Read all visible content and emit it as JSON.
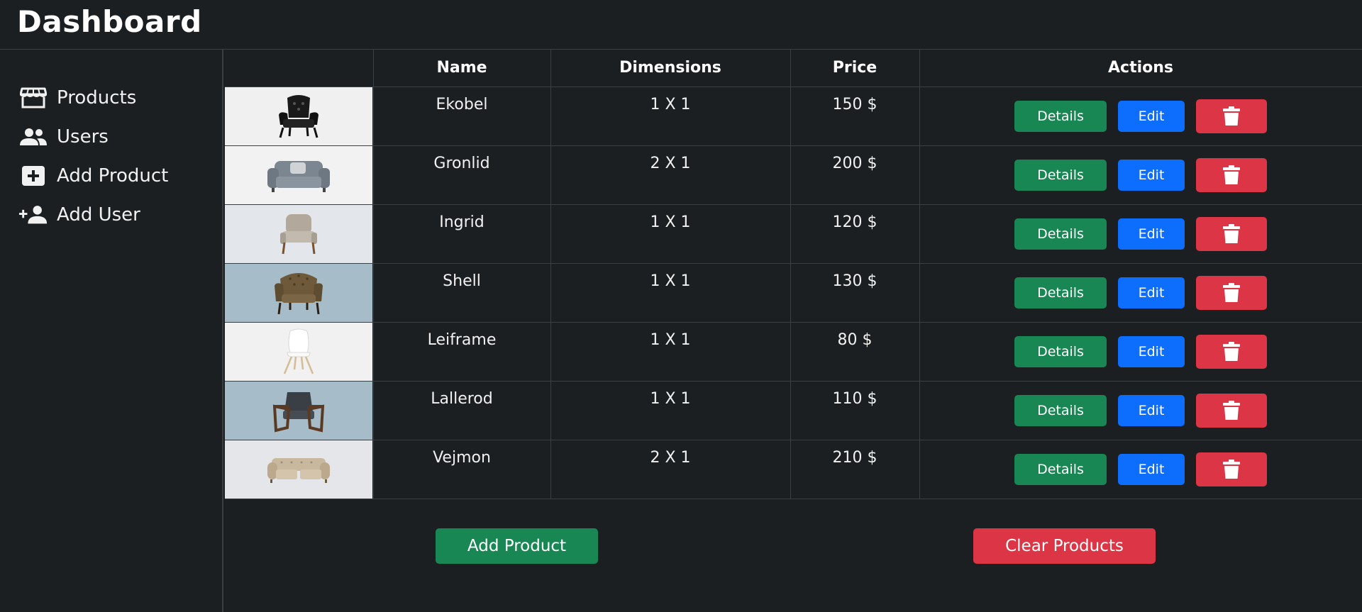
{
  "header": {
    "title": "Dashboard"
  },
  "sidebar": {
    "items": [
      {
        "label": "Products",
        "icon": "store-icon"
      },
      {
        "label": "Users",
        "icon": "users-icon"
      },
      {
        "label": "Add Product",
        "icon": "plus-square-icon"
      },
      {
        "label": "Add User",
        "icon": "user-plus-icon"
      }
    ]
  },
  "table": {
    "columns": [
      "",
      "Name",
      "Dimensions",
      "Price",
      "Actions"
    ],
    "details_label": "Details",
    "edit_label": "Edit",
    "rows": [
      {
        "name": "Ekobel",
        "dimensions": "1 X 1",
        "price": "150 $",
        "bg": "#f0f0f0"
      },
      {
        "name": "Gronlid",
        "dimensions": "2 X 1",
        "price": "200 $",
        "bg": "#f2f2f2"
      },
      {
        "name": "Ingrid",
        "dimensions": "1 X 1",
        "price": "120 $",
        "bg": "#e3e6ea"
      },
      {
        "name": "Shell",
        "dimensions": "1 X 1",
        "price": "130 $",
        "bg": "#a6bcc8"
      },
      {
        "name": "Leiframe",
        "dimensions": "1 X 1",
        "price": "80 $",
        "bg": "#f1f1f1"
      },
      {
        "name": "Lallerod",
        "dimensions": "1 X 1",
        "price": "110 $",
        "bg": "#a6bcc8"
      },
      {
        "name": "Vejmon",
        "dimensions": "2 X 1",
        "price": "210 $",
        "bg": "#e4e6ea"
      }
    ]
  },
  "footer": {
    "add_label": "Add Product",
    "clear_label": "Clear Products"
  },
  "colors": {
    "background": "#1c1f22",
    "success": "#198754",
    "primary": "#0d6efd",
    "danger": "#dc3545"
  }
}
